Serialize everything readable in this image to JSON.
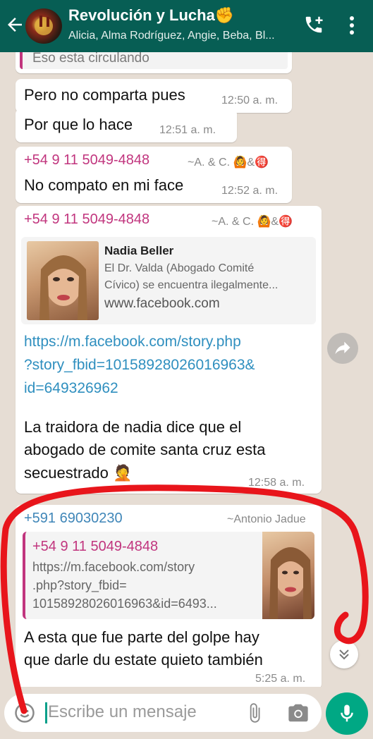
{
  "header": {
    "title": "Revolución y Lucha✊",
    "subtitle": "Alicia, Alma Rodríguez, Angie, Beba, Bl..."
  },
  "messages": {
    "quoted_snippet": "Eso esta circulando",
    "m1": {
      "text": "Pero no comparta pues",
      "time": "12:50 a. m."
    },
    "m2": {
      "text": "Por que lo hace",
      "time": "12:51 a. m."
    },
    "m3": {
      "sender": "+54 9 11 5049-4848",
      "alias": "~A. & C. 🙆&🉐",
      "text": "No compato en mi face",
      "time": "12:52 a. m."
    },
    "m4": {
      "sender": "+54 9 11 5049-4848",
      "alias": "~A. & C. 🙆&🉐",
      "preview_title": "Nadia Beller",
      "preview_desc_1": "El Dr. Valda (Abogado Comité",
      "preview_desc_2": "Cívico) se encuentra ilegalmente...",
      "preview_domain": "www.facebook.com",
      "link_1": "https://m.facebook.com/story.php",
      "link_2": "?story_fbid=10158928026016963&",
      "link_3": "id=649326962",
      "body_1": "La traidora de nadia dice que el",
      "body_2": "abogado de comite santa cruz esta",
      "body_3": "secuestrado 🤦",
      "time": "12:58 a. m."
    },
    "m5": {
      "sender": "+591 69030230",
      "alias": "~Antonio Jadue",
      "quote_sender": "+54 9 11 5049-4848",
      "quote_1": "https://m.facebook.com/story",
      "quote_2": ".php?story_fbid=",
      "quote_3": "10158928026016963&id=6493...",
      "body_1": "A esta que fue parte del golpe hay",
      "body_2": "que darle du estate quieto también",
      "time": "5:25 a. m."
    }
  },
  "composer": {
    "placeholder": "Escribe un mensaje"
  },
  "colors": {
    "header_bg": "#075e54",
    "sender": "#c1357e",
    "link": "#2f8fbf",
    "mic": "#00a884",
    "annotation": "#e8151b"
  }
}
